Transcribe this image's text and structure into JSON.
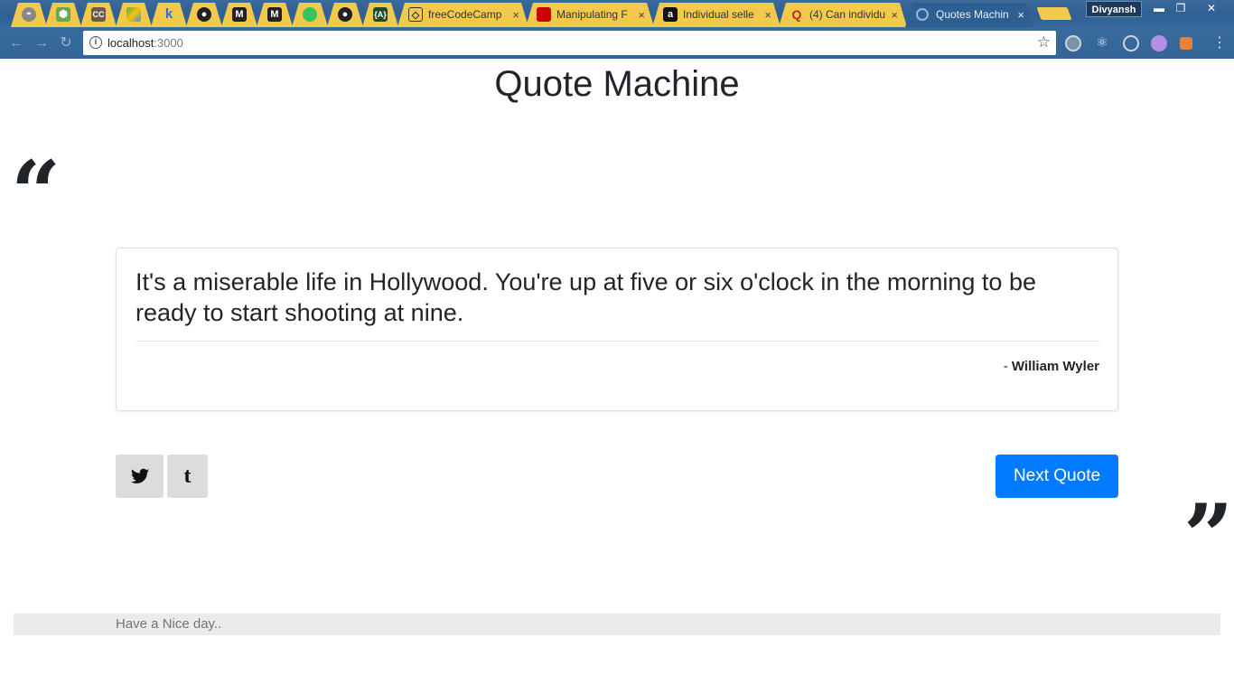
{
  "browser": {
    "tabs": [
      {
        "label": "",
        "icon": "browser-favicon",
        "active": false
      },
      {
        "label": "",
        "icon": "node-icon",
        "active": false
      },
      {
        "label": "",
        "icon": "cc-icon",
        "active": false
      },
      {
        "label": "",
        "icon": "drive-icon",
        "active": false
      },
      {
        "label": "",
        "icon": "k-icon",
        "active": false
      },
      {
        "label": "",
        "icon": "github-icon",
        "active": false
      },
      {
        "label": "",
        "icon": "medium-icon",
        "active": false
      },
      {
        "label": "",
        "icon": "medium-icon",
        "active": false
      },
      {
        "label": "",
        "icon": "green-circle-icon",
        "active": false
      },
      {
        "label": "",
        "icon": "github-icon",
        "active": false
      },
      {
        "label": "",
        "icon": "codecademy-icon",
        "active": false
      },
      {
        "label": "freeCodeCamp",
        "icon": "codepen-icon",
        "active": false
      },
      {
        "label": "Manipulating F",
        "icon": "redhat-icon",
        "active": false
      },
      {
        "label": "Individual selle",
        "icon": "amazon-icon",
        "active": false
      },
      {
        "label": "(4) Can individu",
        "icon": "quora-icon",
        "active": false
      },
      {
        "label": "Quotes Machin",
        "icon": "loading-icon",
        "active": true
      }
    ],
    "close_glyph": "×",
    "profile_name": "Divyansh",
    "url_host": "localhost",
    "url_port": ":3000"
  },
  "page": {
    "title": "Quote Machine",
    "quote": {
      "text": "It's a miserable life in Hollywood. You're up at five or six o'clock in the morning to be ready to start shooting at nine.",
      "author_prefix": "- ",
      "author": "William Wyler"
    },
    "share": {
      "twitter_glyph": "🐦",
      "tumblr_glyph": "t"
    },
    "next_button_label": "Next Quote",
    "footer_text": "Have a Nice day..",
    "open_quote_glyph": "“",
    "close_quote_glyph": "”"
  },
  "colors": {
    "accent": "#007bff",
    "tab_inactive": "#f2c94c",
    "share_button_bg": "#dcdcdc"
  }
}
